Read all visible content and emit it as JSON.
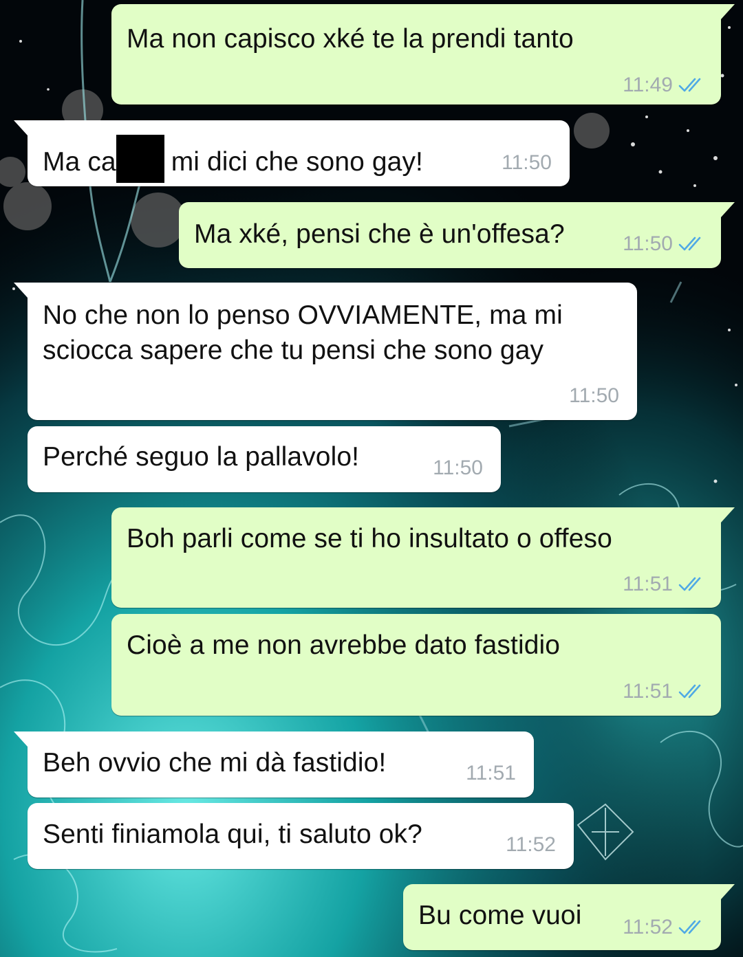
{
  "colors": {
    "outgoing_bubble": "#e1fec6",
    "incoming_bubble": "#ffffff",
    "timestamp": "#a2aab0",
    "read_ticks": "#4fa9e5",
    "wallpaper_accent": "#2ad4d4"
  },
  "icons": {
    "read_receipt": "double-check-icon"
  },
  "messages": [
    {
      "direction": "outgoing",
      "text": "Ma non capisco xké te la prendi tanto",
      "time": "11:49",
      "read": true
    },
    {
      "direction": "incoming",
      "text_before": "Ma ca",
      "redacted": true,
      "text_after": "mi dici che sono gay!",
      "time": "11:50"
    },
    {
      "direction": "outgoing",
      "text": "Ma xké, pensi che è un'offesa?",
      "time": "11:50",
      "read": true
    },
    {
      "direction": "incoming",
      "lines": [
        "No che non lo penso OVVIAMENTE, ma mi",
        "sciocca sapere che tu pensi che sono gay"
      ],
      "time": "11:50"
    },
    {
      "direction": "incoming",
      "text": "Perché seguo la pallavolo!",
      "time": "11:50"
    },
    {
      "direction": "outgoing",
      "text": "Boh parli come se ti ho insultato o offeso",
      "time": "11:51",
      "read": true
    },
    {
      "direction": "outgoing",
      "text": "Cioè a me non avrebbe dato fastidio",
      "time": "11:51",
      "read": true
    },
    {
      "direction": "incoming",
      "text": "Beh ovvio che mi dà fastidio!",
      "time": "11:51"
    },
    {
      "direction": "incoming",
      "text": "Senti finiamola qui, ti saluto ok?",
      "time": "11:52"
    },
    {
      "direction": "outgoing",
      "text": "Bu come vuoi",
      "time": "11:52",
      "read": true
    }
  ]
}
